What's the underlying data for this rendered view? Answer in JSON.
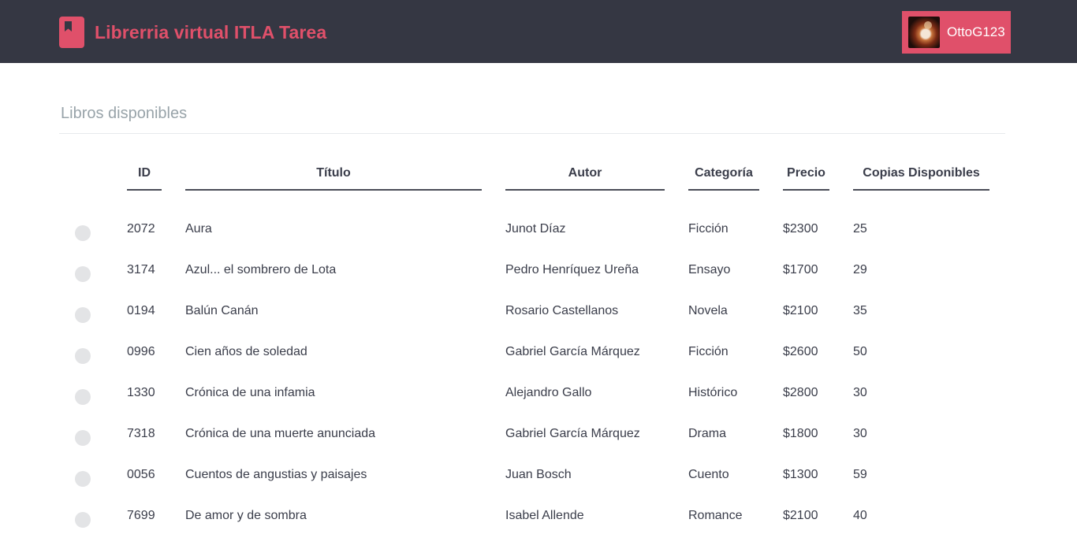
{
  "header": {
    "title": "Librerria virtual ITLA Tarea",
    "logo_icon": "bookmark-icon",
    "user_name": "OttoG123",
    "brand_color": "#e0506a",
    "bar_color": "#353743"
  },
  "section": {
    "title": "Libros disponibles"
  },
  "table": {
    "columns": {
      "id": "ID",
      "titulo": "Título",
      "autor": "Autor",
      "categoria": "Categoría",
      "precio": "Precio",
      "copias": "Copias Disponibles"
    },
    "rows": [
      {
        "id": "2072",
        "titulo": "Aura",
        "autor": "Junot Díaz",
        "categoria": "Ficción",
        "precio": "$2300",
        "copias": "25"
      },
      {
        "id": "3174",
        "titulo": "Azul... el sombrero de Lota",
        "autor": "Pedro Henríquez Ureña",
        "categoria": "Ensayo",
        "precio": "$1700",
        "copias": "29"
      },
      {
        "id": "0194",
        "titulo": "Balún Canán",
        "autor": "Rosario Castellanos",
        "categoria": "Novela",
        "precio": "$2100",
        "copias": "35"
      },
      {
        "id": "0996",
        "titulo": "Cien años de soledad",
        "autor": "Gabriel García Márquez",
        "categoria": "Ficción",
        "precio": "$2600",
        "copias": "50"
      },
      {
        "id": "1330",
        "titulo": "Crónica de una infamia",
        "autor": "Alejandro Gallo",
        "categoria": "Histórico",
        "precio": "$2800",
        "copias": "30"
      },
      {
        "id": "7318",
        "titulo": "Crónica de una muerte anunciada",
        "autor": "Gabriel García Márquez",
        "categoria": "Drama",
        "precio": "$1800",
        "copias": "30"
      },
      {
        "id": "0056",
        "titulo": "Cuentos de angustias y paisajes",
        "autor": "Juan Bosch",
        "categoria": "Cuento",
        "precio": "$1300",
        "copias": "59"
      },
      {
        "id": "7699",
        "titulo": "De amor y de sombra",
        "autor": "Isabel Allende",
        "categoria": "Romance",
        "precio": "$2100",
        "copias": "40"
      }
    ]
  }
}
